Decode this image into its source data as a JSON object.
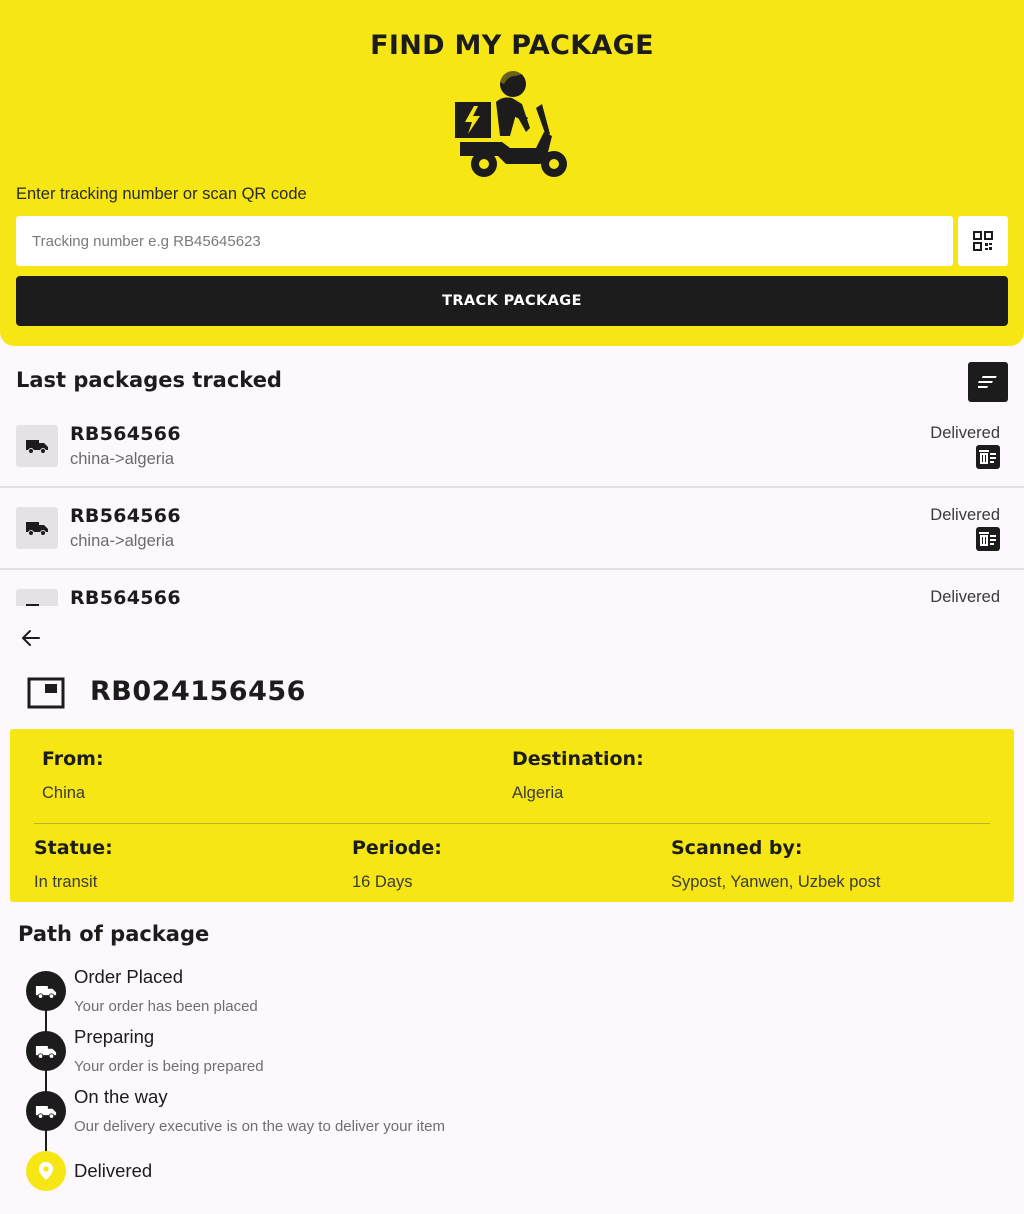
{
  "header": {
    "title": "FIND MY PACKAGE",
    "prompt": "Enter tracking number or scan QR code",
    "tracking_placeholder": "Tracking number e.g RB45645623",
    "track_button": "TRACK PACKAGE"
  },
  "history": {
    "heading": "Last packages tracked",
    "items": [
      {
        "number": "RB564566",
        "route": "china->algeria",
        "status": "Delivered"
      },
      {
        "number": "RB564566",
        "route": "china->algeria",
        "status": "Delivered"
      },
      {
        "number": "RB564566",
        "route": "",
        "status": "Delivered"
      }
    ]
  },
  "detail": {
    "number": "RB024156456",
    "from_label": "From:",
    "from_value": "China",
    "destination_label": "Destination:",
    "destination_value": "Algeria",
    "status_label": "Statue:",
    "status_value": "In transit",
    "period_label": "Periode:",
    "period_value": "16 Days",
    "scanned_label": "Scanned by:",
    "scanned_value": "Sypost, Yanwen, Uzbek post"
  },
  "path": {
    "heading": "Path of package",
    "steps": [
      {
        "title": "Order Placed",
        "desc": "Your order has been placed",
        "icon": "truck-icon"
      },
      {
        "title": "Preparing",
        "desc": "Your order is being prepared",
        "icon": "truck-icon"
      },
      {
        "title": "On the way",
        "desc": "Our delivery executive is on the way to deliver your item",
        "icon": "truck-icon"
      },
      {
        "title": "Delivered",
        "desc": "",
        "icon": "location-pin-icon"
      }
    ]
  },
  "colors": {
    "accent": "#f6e714",
    "dark": "#1c1c1c",
    "background": "#fdf8fd"
  }
}
